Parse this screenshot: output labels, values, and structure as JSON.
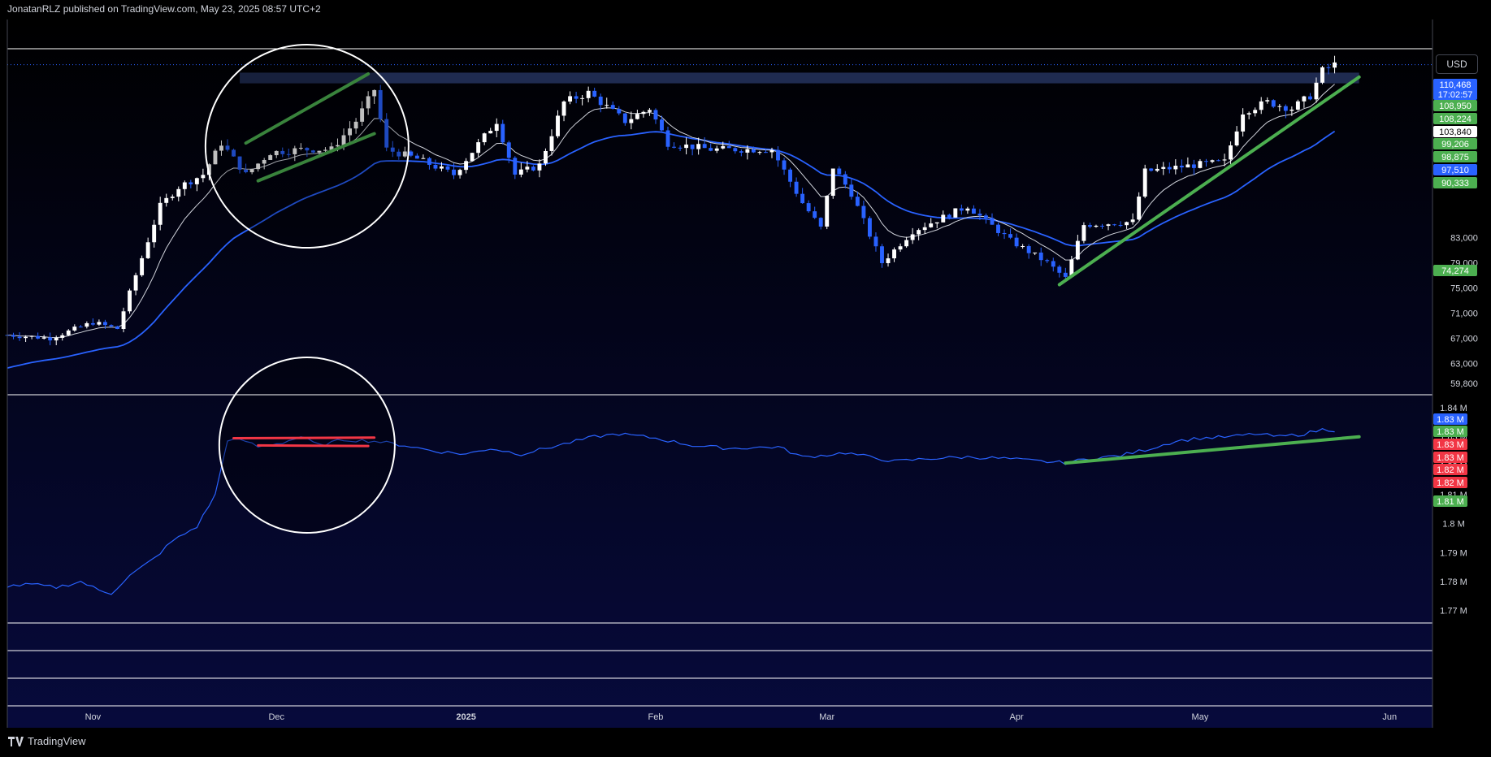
{
  "header": {
    "publish_line": "JonatanRLZ published on TradingView.com, May 23, 2025 08:57 UTC+2"
  },
  "currency_button": "USD",
  "footer": {
    "brand": "TradingView"
  },
  "colors": {
    "background": "#000000",
    "pane_gradient_bottom": "#070a3c",
    "candle_up": "#ffffff",
    "candle_down": "#2962ff",
    "ema_fast": "#d1d4dc",
    "ema_slow": "#2962ff",
    "trendline_green": "#4caf50",
    "trendline_red": "#f23645",
    "resistance_zone": "#2a3a6a"
  },
  "chart_data": [
    {
      "type": "candlestick",
      "symbol_currency": "USD",
      "y_axis_ticks": [
        59800,
        63000,
        67000,
        71000,
        75000,
        79000,
        83000
      ],
      "y_tick_labels": [
        "59,800",
        "63,000",
        "67,000",
        "71,000",
        "75,000",
        "79,000",
        "83,000"
      ],
      "ylim": [
        58000,
        113000
      ],
      "x_axis_labels": [
        "Nov",
        "Dec",
        "2025",
        "Feb",
        "Mar",
        "Apr",
        "May",
        "Jun"
      ],
      "x_label_dates": [
        "2024-11-01",
        "2024-12-01",
        "2025-01-01",
        "2025-02-01",
        "2025-03-01",
        "2025-04-01",
        "2025-05-01",
        "2025-06-01"
      ],
      "date_range": [
        "2024-10-18",
        "2025-06-08"
      ],
      "price_tags": [
        {
          "label": "110,468",
          "value": 110468,
          "color": "#2962ff",
          "countdown": "17:02:57"
        },
        {
          "label": "108,950",
          "value": 108950,
          "color": "#4caf50"
        },
        {
          "label": "108,224",
          "value": 108224,
          "color": "#4caf50"
        },
        {
          "label": "103,840",
          "value": 103840,
          "color": "#ffffff"
        },
        {
          "label": "99,206",
          "value": 99206,
          "color": "#4caf50"
        },
        {
          "label": "98,875",
          "value": 98875,
          "color": "#4caf50"
        },
        {
          "label": "97,510",
          "value": 97510,
          "color": "#2962ff"
        },
        {
          "label": "90,333",
          "value": 90333,
          "color": "#4caf50"
        },
        {
          "label": "74,274",
          "value": 74274,
          "color": "#4caf50"
        }
      ],
      "price_trend": [
        [
          "2024-10-18",
          67500
        ],
        [
          "2024-10-25",
          67000
        ],
        [
          "2024-11-01",
          69500
        ],
        [
          "2024-11-05",
          68500
        ],
        [
          "2024-11-08",
          77000
        ],
        [
          "2024-11-12",
          88000
        ],
        [
          "2024-11-15",
          91000
        ],
        [
          "2024-11-19",
          93000
        ],
        [
          "2024-11-22",
          98000
        ],
        [
          "2024-11-26",
          93000
        ],
        [
          "2024-11-30",
          96500
        ],
        [
          "2024-12-05",
          97000
        ],
        [
          "2024-12-10",
          97000
        ],
        [
          "2024-12-14",
          101500
        ],
        [
          "2024-12-17",
          106500
        ],
        [
          "2024-12-19",
          97000
        ],
        [
          "2024-12-24",
          95500
        ],
        [
          "2024-12-30",
          93000
        ],
        [
          "2025-01-06",
          101500
        ],
        [
          "2025-01-09",
          93000
        ],
        [
          "2025-01-13",
          94500
        ],
        [
          "2025-01-17",
          104500
        ],
        [
          "2025-01-21",
          106000
        ],
        [
          "2025-01-27",
          101500
        ],
        [
          "2025-01-31",
          103500
        ],
        [
          "2025-02-03",
          98000
        ],
        [
          "2025-02-10",
          97000
        ],
        [
          "2025-02-20",
          97000
        ],
        [
          "2025-02-25",
          88500
        ],
        [
          "2025-02-28",
          84500
        ],
        [
          "2025-03-02",
          94200
        ],
        [
          "2025-03-05",
          90000
        ],
        [
          "2025-03-10",
          79000
        ],
        [
          "2025-03-15",
          84000
        ],
        [
          "2025-03-24",
          88000
        ],
        [
          "2025-03-31",
          82500
        ],
        [
          "2025-04-06",
          79000
        ],
        [
          "2025-04-09",
          76500
        ],
        [
          "2025-04-12",
          85000
        ],
        [
          "2025-04-20",
          85500
        ],
        [
          "2025-04-22",
          93500
        ],
        [
          "2025-04-30",
          94500
        ],
        [
          "2025-05-05",
          95000
        ],
        [
          "2025-05-08",
          103000
        ],
        [
          "2025-05-12",
          104500
        ],
        [
          "2025-05-16",
          103500
        ],
        [
          "2025-05-19",
          105500
        ],
        [
          "2025-05-21",
          109500
        ],
        [
          "2025-05-23",
          110468
        ]
      ],
      "resistance_zone": {
        "from": "2024-11-25",
        "to": "2025-05-27",
        "low": 107500,
        "high": 109200
      },
      "trendlines": [
        {
          "color": "green",
          "points": [
            [
              "2024-11-26",
              98000
            ],
            [
              "2024-12-16",
              109000
            ]
          ]
        },
        {
          "color": "green",
          "points": [
            [
              "2024-11-28",
              92000
            ],
            [
              "2024-12-17",
              99500
            ]
          ]
        },
        {
          "color": "green",
          "points": [
            [
              "2025-04-08",
              75500
            ],
            [
              "2025-05-27",
              108500
            ]
          ]
        }
      ],
      "highlight_circle": {
        "center": [
          "2024-12-06",
          97500
        ]
      }
    },
    {
      "type": "line",
      "y_axis_ticks": [
        1.77,
        1.78,
        1.79,
        1.8,
        1.81,
        1.82,
        1.83,
        1.84
      ],
      "y_tick_labels": [
        "1.77 M",
        "1.78 M",
        "1.79 M",
        "1.8 M",
        "1.81 M",
        "1.82 M",
        "1.83 M",
        "1.84 M"
      ],
      "ylim": [
        1.766,
        1.8445
      ],
      "y_unit": "M",
      "value_tags": [
        {
          "label": "1.83 M",
          "value": 1.8325,
          "color": "#2962ff"
        },
        {
          "label": "1.83 M",
          "value": 1.8305,
          "color": "#4caf50"
        },
        {
          "label": "1.83 M",
          "value": 1.8285,
          "color": "#f23645"
        },
        {
          "label": "1.83 M",
          "value": 1.8265,
          "color": "#f23645"
        },
        {
          "label": "1.82 M",
          "value": 1.8245,
          "color": "#f23645"
        },
        {
          "label": "1.82 M",
          "value": 1.8225,
          "color": "#f23645"
        },
        {
          "label": "1.81 M",
          "value": 1.8195,
          "color": "#4caf50"
        }
      ],
      "series": [
        {
          "values": [
            [
              "2024-10-18",
              1.7785
            ],
            [
              "2024-10-22",
              1.779
            ],
            [
              "2024-10-26",
              1.778
            ],
            [
              "2024-10-30",
              1.78
            ],
            [
              "2024-11-02",
              1.777
            ],
            [
              "2024-11-04",
              1.776
            ],
            [
              "2024-11-07",
              1.782
            ],
            [
              "2024-11-11",
              1.788
            ],
            [
              "2024-11-14",
              1.794
            ],
            [
              "2024-11-18",
              1.799
            ],
            [
              "2024-11-21",
              1.81
            ],
            [
              "2024-11-23",
              1.829
            ],
            [
              "2024-11-26",
              1.8285
            ],
            [
              "2024-11-28",
              1.8265
            ],
            [
              "2024-12-02",
              1.828
            ],
            [
              "2024-12-05",
              1.83
            ],
            [
              "2024-12-08",
              1.827
            ],
            [
              "2024-12-12",
              1.829
            ],
            [
              "2024-12-17",
              1.8285
            ],
            [
              "2024-12-22",
              1.827
            ],
            [
              "2024-12-27",
              1.825
            ],
            [
              "2025-01-01",
              1.824
            ],
            [
              "2025-01-05",
              1.826
            ],
            [
              "2025-01-10",
              1.824
            ],
            [
              "2025-01-16",
              1.827
            ],
            [
              "2025-01-22",
              1.83
            ],
            [
              "2025-01-26",
              1.831
            ],
            [
              "2025-02-01",
              1.8295
            ],
            [
              "2025-02-07",
              1.827
            ],
            [
              "2025-02-13",
              1.826
            ],
            [
              "2025-02-21",
              1.8265
            ],
            [
              "2025-02-25",
              1.823
            ],
            [
              "2025-02-28",
              1.8235
            ],
            [
              "2025-03-04",
              1.8245
            ],
            [
              "2025-03-08",
              1.823
            ],
            [
              "2025-03-12",
              1.8215
            ],
            [
              "2025-03-18",
              1.8225
            ],
            [
              "2025-03-24",
              1.823
            ],
            [
              "2025-03-30",
              1.8225
            ],
            [
              "2025-04-05",
              1.8215
            ],
            [
              "2025-04-09",
              1.821
            ],
            [
              "2025-04-13",
              1.8225
            ],
            [
              "2025-04-18",
              1.8235
            ],
            [
              "2025-04-23",
              1.826
            ],
            [
              "2025-04-27",
              1.8285
            ],
            [
              "2025-05-01",
              1.8295
            ],
            [
              "2025-05-06",
              1.83
            ],
            [
              "2025-05-10",
              1.831
            ],
            [
              "2025-05-14",
              1.83
            ],
            [
              "2025-05-18",
              1.831
            ],
            [
              "2025-05-21",
              1.8325
            ],
            [
              "2025-05-23",
              1.8323
            ]
          ]
        }
      ],
      "trendlines": [
        {
          "color": "red",
          "points": [
            [
              "2024-11-24",
              1.8295
            ],
            [
              "2024-12-17",
              1.8297
            ]
          ]
        },
        {
          "color": "red",
          "points": [
            [
              "2024-11-28",
              1.827
            ],
            [
              "2024-12-16",
              1.8268
            ]
          ]
        },
        {
          "color": "green",
          "points": [
            [
              "2025-04-09",
              1.8209
            ],
            [
              "2025-05-27",
              1.83
            ]
          ]
        }
      ],
      "highlight_circle": {
        "center": [
          "2024-12-06",
          1.826
        ]
      }
    }
  ]
}
